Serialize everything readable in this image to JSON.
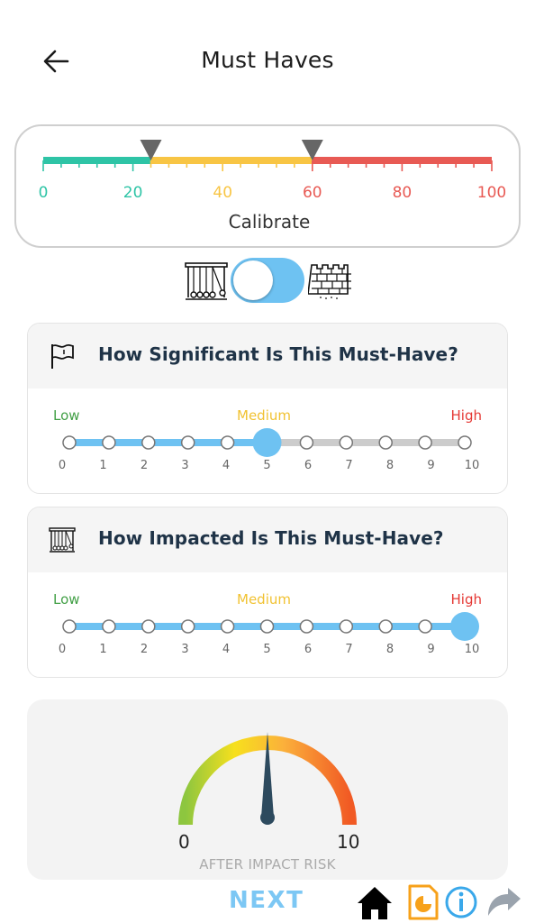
{
  "header": {
    "title": "Must Haves"
  },
  "calibrate": {
    "label": "Calibrate",
    "scale_labels": [
      "0",
      "20",
      "40",
      "60",
      "80",
      "100"
    ],
    "thresholds": [
      24,
      60
    ],
    "colors": {
      "low": "#2ec4a6",
      "mid": "#f8c544",
      "high": "#e85a54"
    }
  },
  "toggle": {
    "state": "off"
  },
  "questions": [
    {
      "title": "How Significant Is This Must-Have?",
      "icon": "flag-icon",
      "levels": {
        "low": "Low",
        "medium": "Medium",
        "high": "High"
      },
      "ticks": [
        "0",
        "1",
        "2",
        "3",
        "4",
        "5",
        "6",
        "7",
        "8",
        "9",
        "10"
      ],
      "value": 5
    },
    {
      "title": "How Impacted Is This Must-Have?",
      "icon": "newtons-cradle-icon",
      "levels": {
        "low": "Low",
        "medium": "Medium",
        "high": "High"
      },
      "ticks": [
        "0",
        "1",
        "2",
        "3",
        "4",
        "5",
        "6",
        "7",
        "8",
        "9",
        "10"
      ],
      "value": 10
    }
  ],
  "gauge": {
    "min_label": "0",
    "max_label": "10",
    "caption": "AFTER IMPACT RISK",
    "value": 5
  },
  "bottom": {
    "next_label": "NEXT",
    "icons": [
      "home-icon",
      "report-icon",
      "info-icon",
      "share-icon"
    ]
  }
}
